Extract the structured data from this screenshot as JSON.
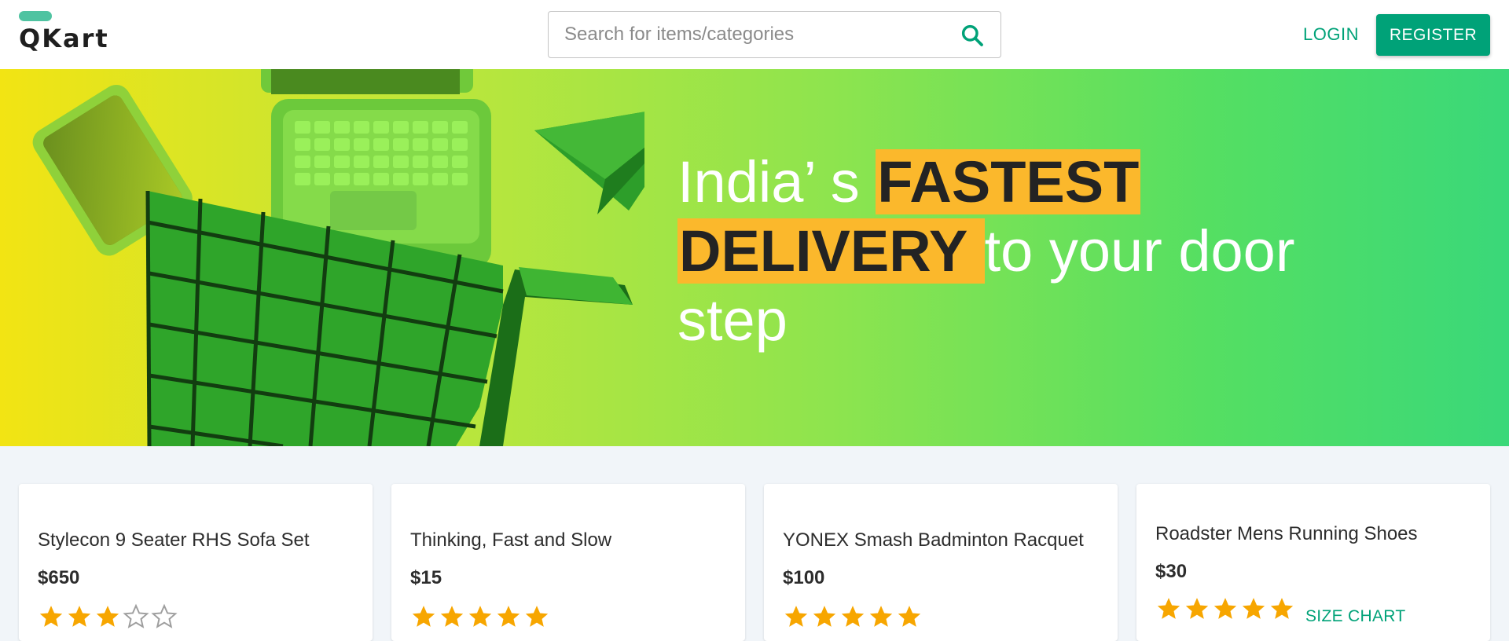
{
  "header": {
    "logo_text": "QKart",
    "search": {
      "placeholder": "Search for items/categories",
      "value": ""
    },
    "login_label": "LOGIN",
    "register_label": "REGISTER"
  },
  "hero": {
    "line1_plain": "India’ s ",
    "line1_highlight": "FASTEST",
    "line2_highlight": "DELIVERY ",
    "line2_plain": " to your door",
    "line3_plain": "step"
  },
  "products": [
    {
      "name": "Stylecon 9 Seater RHS Sofa Set",
      "price": "$650",
      "rating": 3,
      "rating_max": 5
    },
    {
      "name": "Thinking, Fast and Slow",
      "price": "$15",
      "rating": 5,
      "rating_max": 5
    },
    {
      "name": "YONEX Smash Badminton Racquet",
      "price": "$100",
      "rating": 5,
      "rating_max": 5
    },
    {
      "name": "Roadster Mens Running Shoes",
      "price": "$30",
      "rating": 5,
      "rating_max": 5,
      "extra_link": "SIZE CHART"
    }
  ],
  "colors": {
    "brand": "#00a278",
    "star_filled": "#f7a600",
    "star_empty": "#9e9e9e",
    "highlight": "#fbb82c"
  },
  "icons": [
    "search-icon",
    "star-icon",
    "star-outline-icon"
  ]
}
